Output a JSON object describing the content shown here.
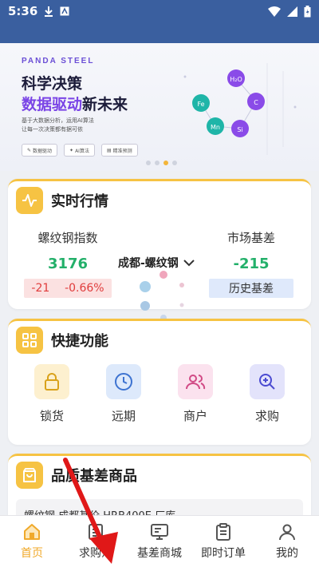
{
  "status_bar": {
    "time": "5:36"
  },
  "banner": {
    "brand": "PANDA STEEL",
    "headline_1": "科学决策",
    "headline_2_accent": "数据驱动",
    "headline_2_rest": "新未来",
    "description_1": "基于大数据分析，运用AI算法",
    "description_2": "让每一次决策都有据可依",
    "chips": [
      "数据驱动",
      "AI算法",
      "精准预测"
    ],
    "elements": [
      "H₂O",
      "Fe",
      "C",
      "Mn",
      "Si"
    ],
    "active_slide": 2,
    "slide_count": 4
  },
  "market": {
    "title": "实时行情",
    "index_label": "螺纹钢指数",
    "index_value": "3176",
    "change_abs": "-21",
    "change_pct": "-0.66%",
    "location_selector": "成都-螺纹钢",
    "basis_label": "市场基差",
    "basis_value": "-215",
    "history_button": "历史基差"
  },
  "quick": {
    "title": "快捷功能",
    "items": [
      {
        "label": "锁货",
        "icon": "lock-icon",
        "bg": "#fdf0cf",
        "color": "#d9a21b"
      },
      {
        "label": "远期",
        "icon": "clock-icon",
        "bg": "#dde9fb",
        "color": "#3d73d1"
      },
      {
        "label": "商户",
        "icon": "users-icon",
        "bg": "#fbe2ee",
        "color": "#d14a85"
      },
      {
        "label": "求购",
        "icon": "search-plus-icon",
        "bg": "#e3e3fb",
        "color": "#4b4bd1"
      }
    ]
  },
  "goods": {
    "title": "品质基差商品",
    "first_row_partial": "螺纹钢 成都基价 HRB400E 厂库"
  },
  "tabbar": {
    "items": [
      {
        "label": "首页",
        "icon": "home-icon",
        "active": true
      },
      {
        "label": "求购池",
        "icon": "list-icon",
        "active": false
      },
      {
        "label": "基差商城",
        "icon": "monitor-icon",
        "active": false
      },
      {
        "label": "即时订单",
        "icon": "clipboard-icon",
        "active": false
      },
      {
        "label": "我的",
        "icon": "user-icon",
        "active": false
      }
    ]
  },
  "colors": {
    "header_blue": "#3a5f9f",
    "accent_yellow": "#f6c343",
    "up_green": "#23b06a",
    "down_red": "#e03c3c",
    "active_tab": "#f0a92a"
  }
}
